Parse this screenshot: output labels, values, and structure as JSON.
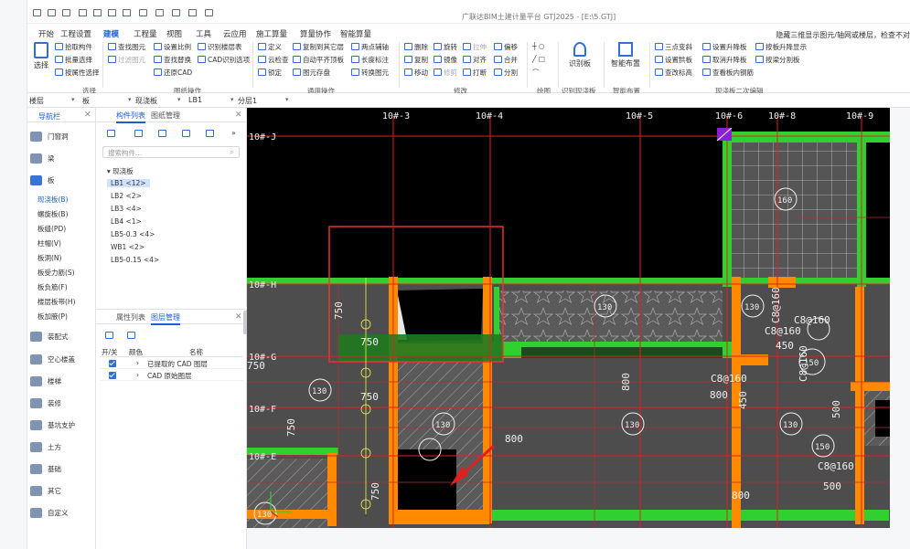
{
  "app": {
    "title": "广联达BIM土建计量平台 GTJ2025 - [E:\\5.GTJ]",
    "hint": "隐藏三维显示图元/轴网或楼层，检查不对"
  },
  "menu": [
    "开始",
    "工程设置",
    "建模",
    "工程量",
    "视图",
    "工具",
    "云应用",
    "施工算量",
    "算量协作",
    "智能算量"
  ],
  "active_menu": "建模",
  "ribbon": {
    "select_label": "选择",
    "select_group": "选择",
    "pick": "拾取构件",
    "batch": "批量选择",
    "byattr": "按属性选择",
    "find": "查找图元",
    "filter": "过滤图元",
    "setscale": "设置比例",
    "findrep": "查找替换",
    "recog_floor": "识别楼层表",
    "cadrecog": "CAD识别选项",
    "restorecad": "还原CAD",
    "cadops_group": "图纸操作",
    "define": "定义",
    "copy_other": "复制到其它层",
    "cloud_check": "云检查",
    "auto_level": "自动平齐顶板",
    "lock": "锁定",
    "layer_ops": "图元存盘",
    "twopoint": "两点辅轴",
    "length_dim": "长度标注",
    "convert": "转换图元",
    "common_group": "通用操作",
    "delete": "删除",
    "rotate": "旋转",
    "stretch": "拉伸",
    "offset": "偏移",
    "copy": "复制",
    "mirror": "镜像",
    "align": "对齐",
    "merge": "合并",
    "move": "移动",
    "trim": "修剪",
    "break": "打断",
    "split": "分割",
    "modify_group": "修改",
    "draw_group": "绘图",
    "recog_slab": "识别板",
    "recog_group": "识别现浇板",
    "smart_layout": "智能布置",
    "smart_group": "智能布置",
    "threepoint": "三点变斜",
    "set_rise": "设置升降板",
    "show_rise": "按板升降显示",
    "set_arch": "设置拱板",
    "cancel_rise": "取消升降板",
    "split_slab": "按梁分割板",
    "view_node": "查看板内钢筋",
    "sub_group": "现浇板二次编辑",
    "view_ctrl": "查改标高"
  },
  "selectors": {
    "floor": "楼层",
    "type": "板",
    "kind": "现浇板",
    "name": "LB1",
    "layer": "分层1"
  },
  "nav": {
    "tab": "导航栏",
    "categories": [
      "门窗洞",
      "梁",
      "板",
      "装配式",
      "空心楼盖",
      "楼梯",
      "装修",
      "基坑支护",
      "土方",
      "基础",
      "其它",
      "自定义"
    ],
    "slab_items": [
      "现浇板(B)",
      "螺旋板(B)",
      "柱帽(V)",
      "板洞(N)",
      "板受力筋(S)",
      "板负筋(F)",
      "楼层板带(H)",
      "板加腋(P)",
      "板缝(PD)"
    ]
  },
  "components": {
    "tab_list": "构件列表",
    "tab_drawing": "图纸管理",
    "search_placeholder": "搜索构件...",
    "group": "现浇板",
    "items": [
      "LB1 <12>",
      "LB2 <2>",
      "LB3 <4>",
      "LB4 <1>",
      "LB5-0.3 <4>",
      "WB1 <2>",
      "LB5-0.15 <4>"
    ]
  },
  "layers": {
    "tab_prop": "属性列表",
    "tab_layer": "图层管理",
    "col_toggle": "开/关",
    "col_color": "颜色",
    "col_name": "名称",
    "rows": [
      "已提取的 CAD 图层",
      "CAD 原始图层"
    ]
  },
  "canvas": {
    "axis_top": [
      "10#-3",
      "10#-4",
      "10#-5",
      "10#-6",
      "10#-8",
      "10#-9"
    ],
    "axis_left": [
      "10#-J",
      "10#-H",
      "10#-G",
      "10#-F",
      "10#-E"
    ],
    "circles": [
      "160",
      "130",
      "130",
      "130",
      "150",
      "130",
      "130",
      "130",
      "150",
      "130"
    ],
    "rebar": [
      "C8@160",
      "C8@160",
      "C8@160",
      "C8@160",
      "C8@160",
      "C8@160"
    ],
    "dims": [
      "750",
      "750",
      "750",
      "750",
      "750",
      "750",
      "800",
      "800",
      "800",
      "800",
      "450",
      "450",
      "500",
      "500"
    ]
  }
}
